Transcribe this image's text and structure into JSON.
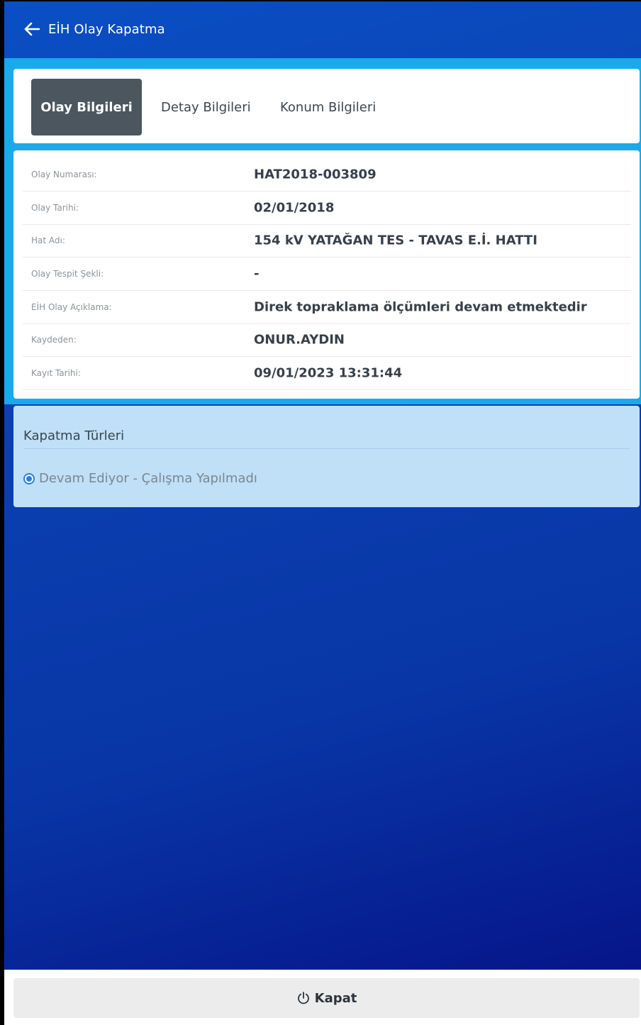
{
  "header": {
    "title": "EİH Olay Kapatma",
    "back_icon": "arrow-left-icon"
  },
  "tabs": [
    {
      "label": "Olay Bilgileri",
      "active": true
    },
    {
      "label": "Detay Bilgileri",
      "active": false
    },
    {
      "label": "Konum Bilgileri",
      "active": false
    }
  ],
  "info": [
    {
      "label": "Olay Numarası:",
      "value": "HAT2018-003809"
    },
    {
      "label": "Olay Tarihi:",
      "value": "02/01/2018"
    },
    {
      "label": "Hat Adı:",
      "value": "154 kV YATAĞAN TES - TAVAS E.İ. HATTI"
    },
    {
      "label": "Olay Tespit Şekli:",
      "value": "-"
    },
    {
      "label": "EİH Olay Açıklama:",
      "value": "Direk topraklama ölçümleri devam etmektedir"
    },
    {
      "label": "Kaydeden:",
      "value": "ONUR.AYDIN"
    },
    {
      "label": "Kayıt Tarihi:",
      "value": "09/01/2023 13:31:44"
    }
  ],
  "closing": {
    "title": "Kapatma Türleri",
    "options": [
      {
        "label": "Devam Ediyor - Çalışma Yapılmadı",
        "selected": true
      }
    ]
  },
  "footer": {
    "button_label": "Kapat",
    "button_icon": "power-icon"
  },
  "colors": {
    "header_gradient_start": "#0a4fc4",
    "header_gradient_end": "#06158a",
    "band": "#1aa9ea",
    "active_tab": "#4c565f",
    "closing_card": "#bfe0f7",
    "radio": "#2f7de1"
  }
}
